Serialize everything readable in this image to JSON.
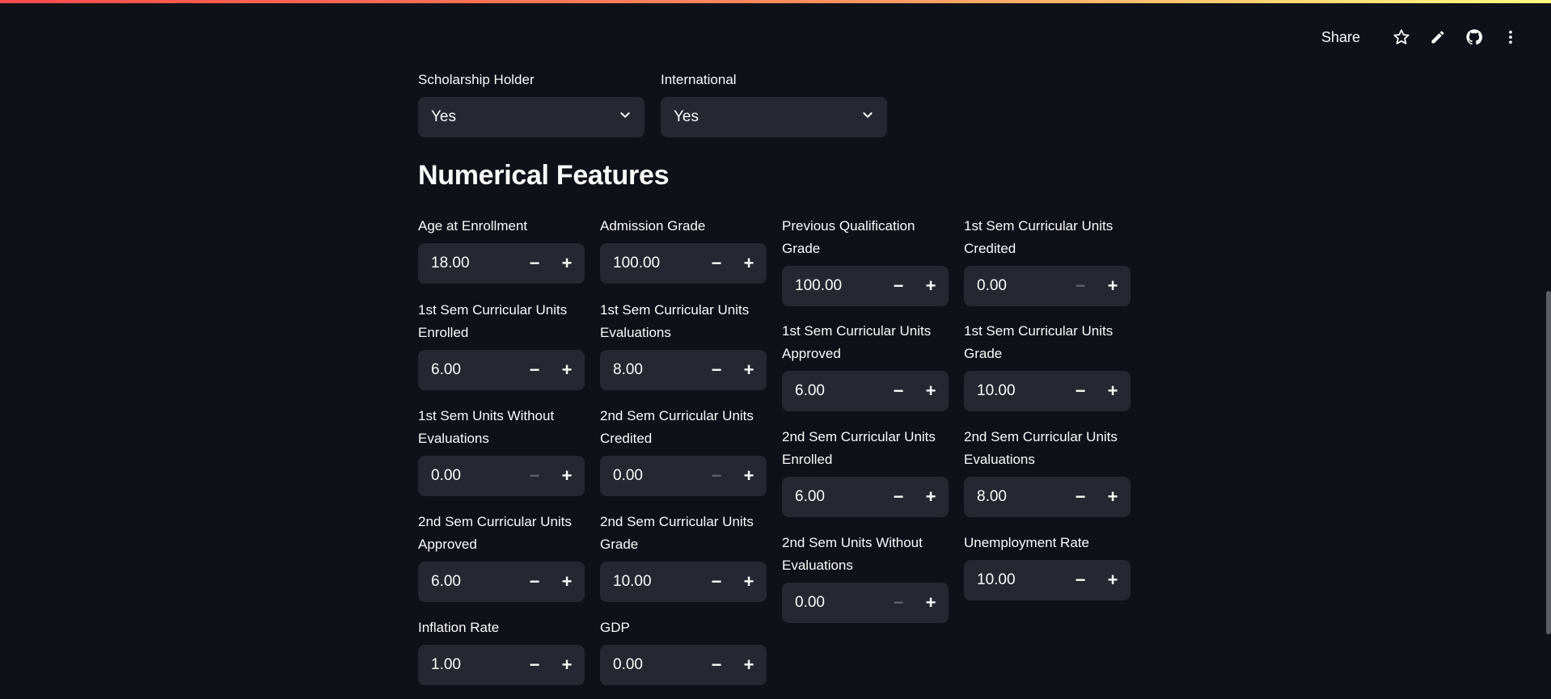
{
  "toolbar": {
    "share_label": "Share",
    "icons": [
      "star-icon",
      "pencil-icon",
      "github-icon",
      "more-vertical-icon"
    ]
  },
  "categorical": [
    {
      "label": "Scholarship Holder",
      "value": "Yes"
    },
    {
      "label": "International",
      "value": "Yes"
    }
  ],
  "section_title": "Numerical Features",
  "columns": [
    [
      {
        "label": "Age at Enrollment",
        "value": "18.00",
        "minus_disabled": false
      },
      {
        "label": "1st Sem Curricular Units Enrolled",
        "value": "6.00",
        "minus_disabled": false
      },
      {
        "label": "1st Sem Units Without Evaluations",
        "value": "0.00",
        "minus_disabled": true
      },
      {
        "label": "2nd Sem Curricular Units Approved",
        "value": "6.00",
        "minus_disabled": false
      },
      {
        "label": "Inflation Rate",
        "value": "1.00",
        "minus_disabled": false
      }
    ],
    [
      {
        "label": "Admission Grade",
        "value": "100.00",
        "minus_disabled": false
      },
      {
        "label": "1st Sem Curricular Units Evaluations",
        "value": "8.00",
        "minus_disabled": false
      },
      {
        "label": "2nd Sem Curricular Units Credited",
        "value": "0.00",
        "minus_disabled": true
      },
      {
        "label": "2nd Sem Curricular Units Grade",
        "value": "10.00",
        "minus_disabled": false
      },
      {
        "label": "GDP",
        "value": "0.00",
        "minus_disabled": false
      }
    ],
    [
      {
        "label": "Previous Qualification Grade",
        "value": "100.00",
        "minus_disabled": false
      },
      {
        "label": "1st Sem Curricular Units Approved",
        "value": "6.00",
        "minus_disabled": false
      },
      {
        "label": "2nd Sem Curricular Units Enrolled",
        "value": "6.00",
        "minus_disabled": false
      },
      {
        "label": "2nd Sem Units Without Evaluations",
        "value": "0.00",
        "minus_disabled": true
      }
    ],
    [
      {
        "label": "1st Sem Curricular Units Credited",
        "value": "0.00",
        "minus_disabled": true
      },
      {
        "label": "1st Sem Curricular Units Grade",
        "value": "10.00",
        "minus_disabled": false
      },
      {
        "label": "2nd Sem Curricular Units Evaluations",
        "value": "8.00",
        "minus_disabled": false
      },
      {
        "label": "Unemployment Rate",
        "value": "10.00",
        "minus_disabled": false
      }
    ]
  ],
  "stepper": {
    "minus": "−",
    "plus": "+"
  },
  "colors": {
    "background": "#0e1117",
    "widget": "#262730",
    "text": "#fafafa",
    "disabled": "#5e6068"
  }
}
